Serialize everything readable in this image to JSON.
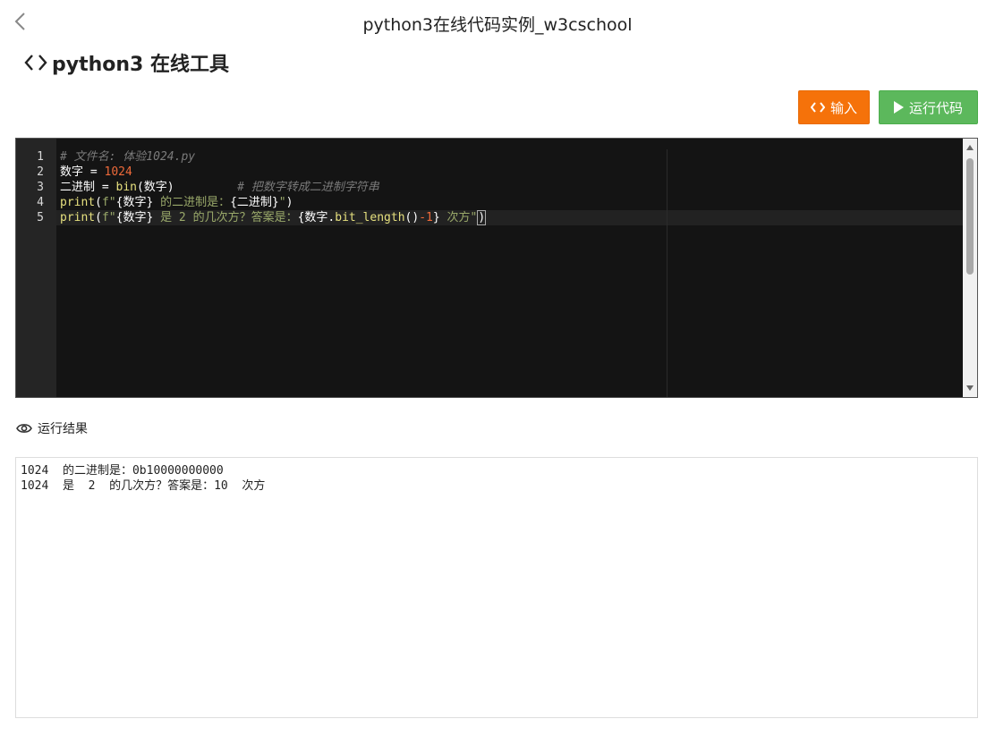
{
  "window": {
    "title": "python3在线代码实例_w3cschool"
  },
  "header": {
    "title": "python3 在线工具"
  },
  "toolbar": {
    "input_label": "输入",
    "run_label": "运行代码"
  },
  "editor": {
    "line_numbers": [
      "1",
      "2",
      "3",
      "4",
      "5"
    ],
    "lines": {
      "l1": {
        "comment": "# 文件名: 体验1024.py"
      },
      "l2": {
        "var": "数字",
        "op": " = ",
        "num": "1024"
      },
      "l3": {
        "var": "二进制",
        "op": " = ",
        "fn": "bin",
        "arg": "(数字)",
        "pad": "         ",
        "comment": "# 把数字转成二进制字符串"
      },
      "l4": {
        "fn": "print",
        "p1": "(",
        "s1": "f\"",
        "t1": "{数字}",
        "s2": " 的二进制是：",
        "t2": "{二进制}",
        "s3": "\"",
        "p2": ")"
      },
      "l5": {
        "fn": "print",
        "p1": "(",
        "s1": "f\"",
        "t1": "{数字}",
        "s2": " 是 2 的几次方？答案是：",
        "t2": "{数字.",
        "fn2": "bit_length",
        "t3": "()",
        "op": "-",
        "num": "1",
        "t4": "}",
        "s3": " 次方\"",
        "p2": ")"
      }
    }
  },
  "result": {
    "label": "运行结果",
    "lines": [
      "1024  的二进制是：0b10000000000",
      "1024  是  2  的几次方？答案是：10  次方"
    ]
  },
  "colors": {
    "input_button": "#f5720a",
    "run_button": "#5cb85c",
    "editor_bg": "#141414"
  },
  "icons": {
    "back": "chevron-left-icon",
    "code": "code-brackets-icon",
    "run": "play-icon",
    "result": "eye-icon"
  }
}
